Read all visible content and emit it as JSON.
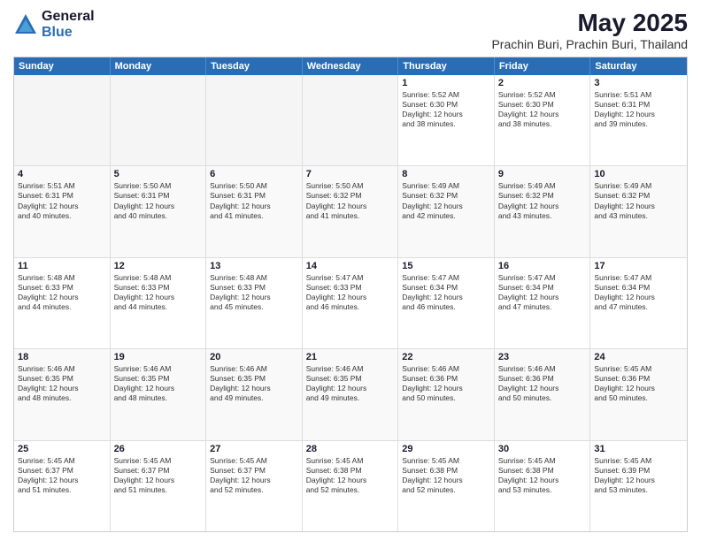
{
  "logo": {
    "general": "General",
    "blue": "Blue"
  },
  "title": "May 2025",
  "subtitle": "Prachin Buri, Prachin Buri, Thailand",
  "dayNames": [
    "Sunday",
    "Monday",
    "Tuesday",
    "Wednesday",
    "Thursday",
    "Friday",
    "Saturday"
  ],
  "weeks": [
    [
      {
        "day": "",
        "info": ""
      },
      {
        "day": "",
        "info": ""
      },
      {
        "day": "",
        "info": ""
      },
      {
        "day": "",
        "info": ""
      },
      {
        "day": "1",
        "info": "Sunrise: 5:52 AM\nSunset: 6:30 PM\nDaylight: 12 hours\nand 38 minutes."
      },
      {
        "day": "2",
        "info": "Sunrise: 5:52 AM\nSunset: 6:30 PM\nDaylight: 12 hours\nand 38 minutes."
      },
      {
        "day": "3",
        "info": "Sunrise: 5:51 AM\nSunset: 6:31 PM\nDaylight: 12 hours\nand 39 minutes."
      }
    ],
    [
      {
        "day": "4",
        "info": "Sunrise: 5:51 AM\nSunset: 6:31 PM\nDaylight: 12 hours\nand 40 minutes."
      },
      {
        "day": "5",
        "info": "Sunrise: 5:50 AM\nSunset: 6:31 PM\nDaylight: 12 hours\nand 40 minutes."
      },
      {
        "day": "6",
        "info": "Sunrise: 5:50 AM\nSunset: 6:31 PM\nDaylight: 12 hours\nand 41 minutes."
      },
      {
        "day": "7",
        "info": "Sunrise: 5:50 AM\nSunset: 6:32 PM\nDaylight: 12 hours\nand 41 minutes."
      },
      {
        "day": "8",
        "info": "Sunrise: 5:49 AM\nSunset: 6:32 PM\nDaylight: 12 hours\nand 42 minutes."
      },
      {
        "day": "9",
        "info": "Sunrise: 5:49 AM\nSunset: 6:32 PM\nDaylight: 12 hours\nand 43 minutes."
      },
      {
        "day": "10",
        "info": "Sunrise: 5:49 AM\nSunset: 6:32 PM\nDaylight: 12 hours\nand 43 minutes."
      }
    ],
    [
      {
        "day": "11",
        "info": "Sunrise: 5:48 AM\nSunset: 6:33 PM\nDaylight: 12 hours\nand 44 minutes."
      },
      {
        "day": "12",
        "info": "Sunrise: 5:48 AM\nSunset: 6:33 PM\nDaylight: 12 hours\nand 44 minutes."
      },
      {
        "day": "13",
        "info": "Sunrise: 5:48 AM\nSunset: 6:33 PM\nDaylight: 12 hours\nand 45 minutes."
      },
      {
        "day": "14",
        "info": "Sunrise: 5:47 AM\nSunset: 6:33 PM\nDaylight: 12 hours\nand 46 minutes."
      },
      {
        "day": "15",
        "info": "Sunrise: 5:47 AM\nSunset: 6:34 PM\nDaylight: 12 hours\nand 46 minutes."
      },
      {
        "day": "16",
        "info": "Sunrise: 5:47 AM\nSunset: 6:34 PM\nDaylight: 12 hours\nand 47 minutes."
      },
      {
        "day": "17",
        "info": "Sunrise: 5:47 AM\nSunset: 6:34 PM\nDaylight: 12 hours\nand 47 minutes."
      }
    ],
    [
      {
        "day": "18",
        "info": "Sunrise: 5:46 AM\nSunset: 6:35 PM\nDaylight: 12 hours\nand 48 minutes."
      },
      {
        "day": "19",
        "info": "Sunrise: 5:46 AM\nSunset: 6:35 PM\nDaylight: 12 hours\nand 48 minutes."
      },
      {
        "day": "20",
        "info": "Sunrise: 5:46 AM\nSunset: 6:35 PM\nDaylight: 12 hours\nand 49 minutes."
      },
      {
        "day": "21",
        "info": "Sunrise: 5:46 AM\nSunset: 6:35 PM\nDaylight: 12 hours\nand 49 minutes."
      },
      {
        "day": "22",
        "info": "Sunrise: 5:46 AM\nSunset: 6:36 PM\nDaylight: 12 hours\nand 50 minutes."
      },
      {
        "day": "23",
        "info": "Sunrise: 5:46 AM\nSunset: 6:36 PM\nDaylight: 12 hours\nand 50 minutes."
      },
      {
        "day": "24",
        "info": "Sunrise: 5:45 AM\nSunset: 6:36 PM\nDaylight: 12 hours\nand 50 minutes."
      }
    ],
    [
      {
        "day": "25",
        "info": "Sunrise: 5:45 AM\nSunset: 6:37 PM\nDaylight: 12 hours\nand 51 minutes."
      },
      {
        "day": "26",
        "info": "Sunrise: 5:45 AM\nSunset: 6:37 PM\nDaylight: 12 hours\nand 51 minutes."
      },
      {
        "day": "27",
        "info": "Sunrise: 5:45 AM\nSunset: 6:37 PM\nDaylight: 12 hours\nand 52 minutes."
      },
      {
        "day": "28",
        "info": "Sunrise: 5:45 AM\nSunset: 6:38 PM\nDaylight: 12 hours\nand 52 minutes."
      },
      {
        "day": "29",
        "info": "Sunrise: 5:45 AM\nSunset: 6:38 PM\nDaylight: 12 hours\nand 52 minutes."
      },
      {
        "day": "30",
        "info": "Sunrise: 5:45 AM\nSunset: 6:38 PM\nDaylight: 12 hours\nand 53 minutes."
      },
      {
        "day": "31",
        "info": "Sunrise: 5:45 AM\nSunset: 6:39 PM\nDaylight: 12 hours\nand 53 minutes."
      }
    ]
  ]
}
